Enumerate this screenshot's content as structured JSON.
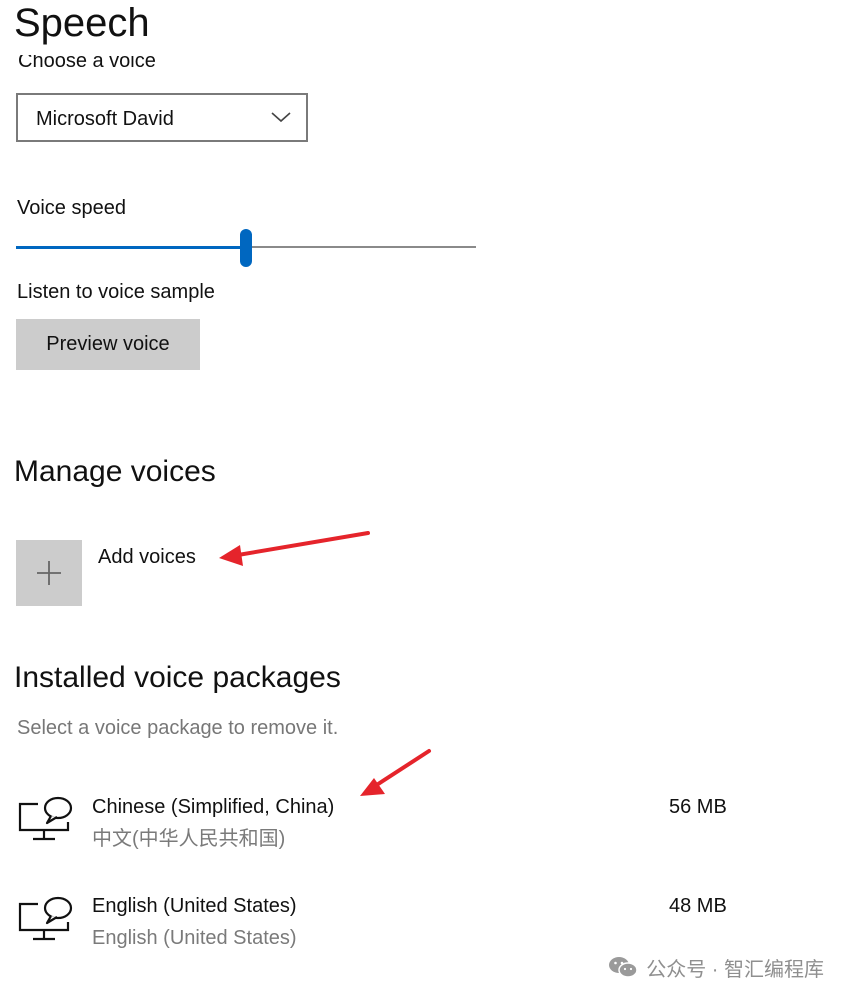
{
  "page": {
    "title": "Speech"
  },
  "voice": {
    "label": "Choose a voice",
    "selected": "Microsoft David",
    "speed_label": "Voice speed",
    "speed_value": 0.5,
    "sample_label": "Listen to voice sample",
    "preview_button": "Preview voice"
  },
  "manage": {
    "title": "Manage voices",
    "add_label": "Add voices"
  },
  "installed": {
    "title": "Installed voice packages",
    "hint": "Select a voice package to remove it.",
    "packages": [
      {
        "name": "Chinese (Simplified, China)",
        "native": "中文(中华人民共和国)",
        "size": "56 MB"
      },
      {
        "name": "English (United States)",
        "native": "English (United States)",
        "size": "48 MB"
      }
    ]
  },
  "watermark": {
    "text": "公众号 · 智汇编程库"
  },
  "colors": {
    "accent": "#0067c0",
    "annotation_arrow": "#e5242b"
  }
}
